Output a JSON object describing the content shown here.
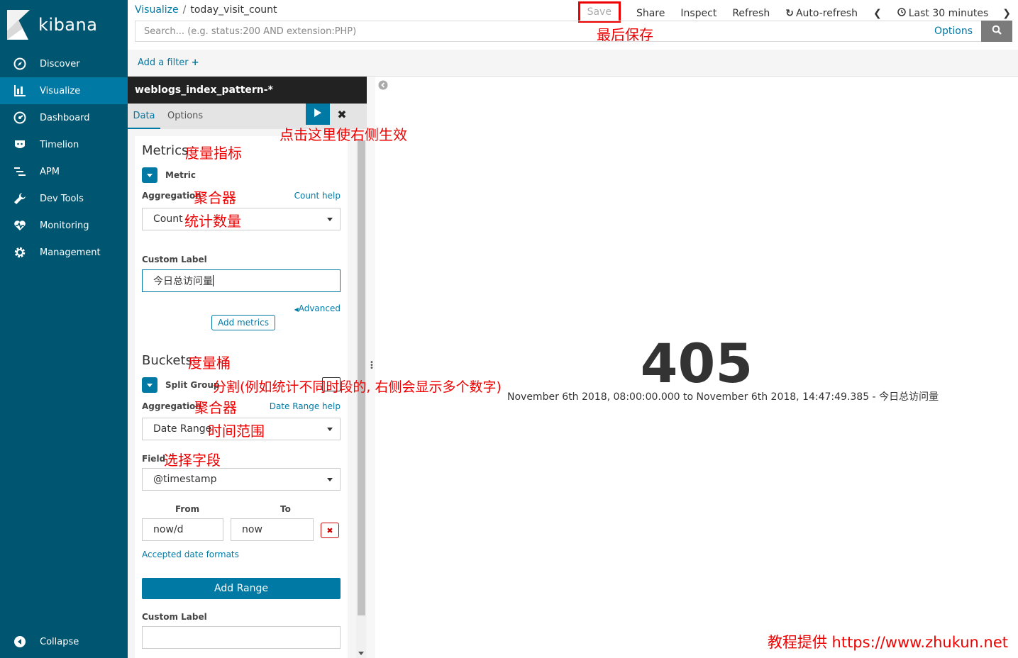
{
  "app": {
    "name": "kibana"
  },
  "sidebar": {
    "items": [
      {
        "label": "Discover",
        "icon": "compass-icon"
      },
      {
        "label": "Visualize",
        "icon": "bar-chart-icon",
        "active": true
      },
      {
        "label": "Dashboard",
        "icon": "dashboard-icon"
      },
      {
        "label": "Timelion",
        "icon": "timelion-icon"
      },
      {
        "label": "APM",
        "icon": "apm-icon"
      },
      {
        "label": "Dev Tools",
        "icon": "wrench-icon"
      },
      {
        "label": "Monitoring",
        "icon": "heartbeat-icon"
      },
      {
        "label": "Management",
        "icon": "gear-icon"
      }
    ],
    "collapse_label": "Collapse"
  },
  "breadcrumb": {
    "parent": "Visualize",
    "current": "today_visit_count"
  },
  "top_actions": {
    "save": "Save",
    "share": "Share",
    "inspect": "Inspect",
    "refresh": "Refresh",
    "auto_refresh": "Auto-refresh",
    "time_range": "Last 30 minutes"
  },
  "search": {
    "placeholder": "Search... (e.g. status:200 AND extension:PHP)",
    "options": "Options"
  },
  "filter": {
    "add_label": "Add a filter"
  },
  "editor": {
    "index_pattern": "weblogs_index_pattern-*",
    "tabs": {
      "data": "Data",
      "options": "Options"
    },
    "metrics": {
      "title": "Metrics",
      "metric_label": "Metric",
      "aggregation_label": "Aggregation",
      "count_help": "Count help",
      "aggregation_value": "Count",
      "custom_label_title": "Custom Label",
      "custom_label_value": "今日总访问量",
      "advanced": "Advanced",
      "add_metrics": "Add metrics"
    },
    "buckets": {
      "title": "Buckets",
      "split_group": "Split Group",
      "aggregation_label": "Aggregation",
      "date_range_help": "Date Range help",
      "aggregation_value": "Date Range",
      "field_label": "Field",
      "field_value": "@timestamp",
      "from_label": "From",
      "to_label": "To",
      "from_value": "now/d",
      "to_value": "now",
      "accepted_formats": "Accepted date formats",
      "add_range": "Add Range",
      "custom_label_title": "Custom Label"
    }
  },
  "annotations": {
    "save": "最后保存",
    "apply": "点击这里使右侧生效",
    "metrics": "度量指标",
    "aggregation1": "聚合器",
    "count": "统计数量",
    "buckets": "度量桶",
    "split": "分割(例如统计不同时段的, 右侧会显示多个数字)",
    "aggregation2": "聚合器",
    "date_range": "时间范围",
    "field": "选择字段"
  },
  "visualization": {
    "value": "405",
    "label": "November 6th 2018, 08:00:00.000 to November 6th 2018, 14:47:49.385 - 今日总访问量"
  },
  "watermark": "教程提供 https://www.zhukun.net",
  "colors": {
    "sidebar": "#005571",
    "accent": "#0079a5",
    "annotation": "#e00000"
  }
}
